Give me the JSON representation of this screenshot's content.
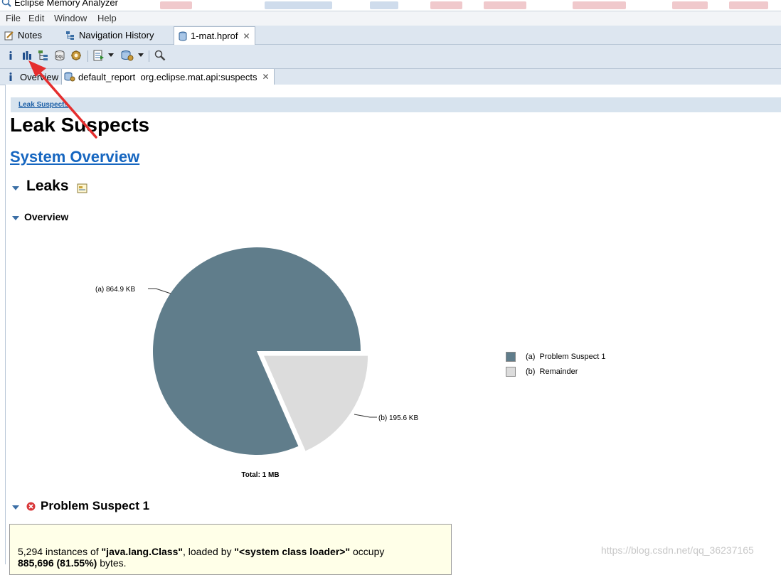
{
  "window": {
    "title": "Eclipse Memory Analyzer"
  },
  "menu": [
    "File",
    "Edit",
    "Window",
    "Help"
  ],
  "tabs": [
    {
      "label": "Notes",
      "icon": "notes-icon"
    },
    {
      "label": "Navigation History",
      "icon": "navigation-history-icon"
    },
    {
      "label": "1-mat.hprof",
      "icon": "heap-dump-icon",
      "active": true,
      "close": "✕"
    }
  ],
  "toolbar": {
    "buttons": [
      "info-icon",
      "histogram-icon",
      "dominator-tree-icon",
      "oql-icon",
      "thread-overview-icon",
      "run-report-icon",
      "query-browser-icon",
      "search-icon"
    ]
  },
  "subtabs": [
    {
      "label": "Overview",
      "icon": "info-icon"
    },
    {
      "label": "default_report  org.eclipse.mat.api:suspects",
      "icon": "report-icon",
      "close": "✕"
    }
  ],
  "report": {
    "breadcrumb": "Leak Suspects",
    "title": "Leak Suspects",
    "system_overview_link": "System Overview",
    "leaks_heading": "Leaks",
    "overview_heading": "Overview",
    "problem_heading": "Problem Suspect 1",
    "suspect": {
      "instances": "5,294",
      "text1": " instances of ",
      "class_name": "\"java.lang.Class\"",
      "text2": ", loaded by ",
      "loader": "\"<system class loader>\"",
      "text3": " occupy ",
      "bytes": "885,696 (81.55%)",
      "text4": " bytes."
    }
  },
  "chart_data": {
    "type": "pie",
    "slices": [
      {
        "label": "(a)  864.9 KB",
        "legend": "(a)  Problem Suspect 1",
        "value": 864.9,
        "color": "#607d8b"
      },
      {
        "label": "(b)  195.6 KB",
        "legend": "(b)  Remainder",
        "value": 195.6,
        "color": "#dcdcdc"
      }
    ],
    "total": "Total: 1 MB",
    "legend_position": "right"
  },
  "watermark": "https://blog.csdn.net/qq_36237165"
}
